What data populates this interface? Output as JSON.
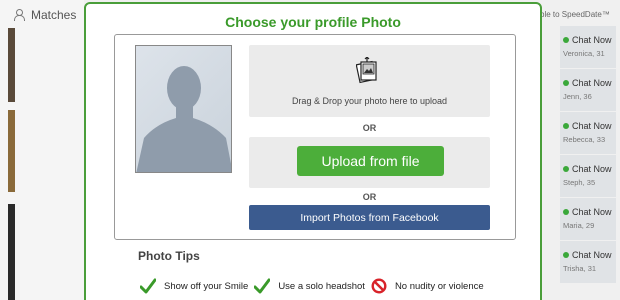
{
  "background": {
    "matches_label": "Matches",
    "right_header": "ble to SpeedDate™",
    "chat_list": [
      {
        "status": "Chat Now",
        "name": "Veronica, 31"
      },
      {
        "status": "Chat Now",
        "name": "Jenn, 36"
      },
      {
        "status": "Chat Now",
        "name": "Rebecca, 33"
      },
      {
        "status": "Chat Now",
        "name": "Steph, 35"
      },
      {
        "status": "Chat Now",
        "name": "Maria, 29"
      },
      {
        "status": "Chat Now",
        "name": "Trisha, 31"
      }
    ]
  },
  "modal": {
    "title": "Choose your profile Photo",
    "drop_text": "Drag & Drop your photo here to upload",
    "or1": "OR",
    "upload_button": "Upload from file",
    "or2": "OR",
    "facebook_button": "Import Photos from Facebook"
  },
  "tips": {
    "title": "Photo Tips",
    "items": [
      "Show off your Smile",
      "Use a solo headshot",
      "No nudity or violence"
    ]
  },
  "colors": {
    "accent_green": "#3a9a2a",
    "upload_green": "#4cae3a",
    "facebook_blue": "#3b5b8f",
    "forbid_red": "#d8232a"
  }
}
